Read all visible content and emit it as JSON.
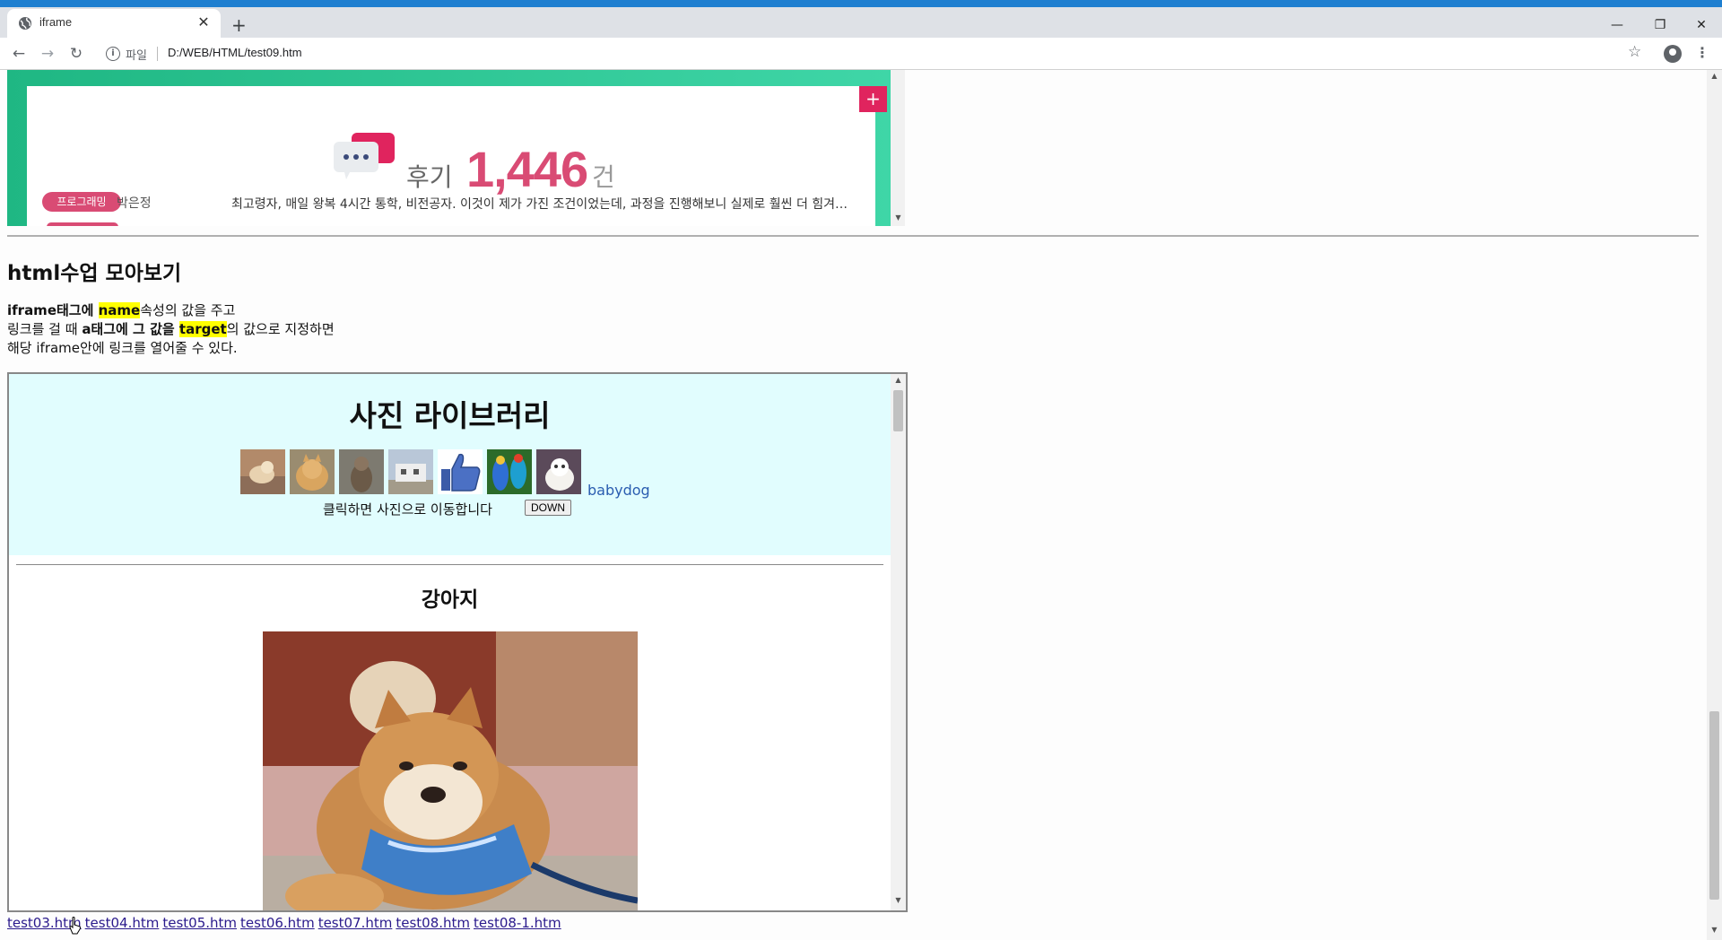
{
  "browser": {
    "tab_title": "iframe",
    "tab_close": "✕",
    "new_tab": "+",
    "window_controls": {
      "minimize": "—",
      "restore": "❐",
      "close": "✕"
    },
    "nav": {
      "back": "←",
      "forward": "→",
      "reload": "↻"
    },
    "address": {
      "info": "i",
      "scheme_label": "파일",
      "url": "D:/WEB/HTML/test09.htm"
    },
    "star": "☆",
    "menu": "⋮"
  },
  "review_banner": {
    "plus": "+",
    "label": "후기",
    "count": "1,446",
    "unit": "건",
    "badge": "프로그래밍",
    "author": "박은정",
    "text": "최고령자, 매일 왕복 4시간 통학, 비전공자. 이것이 제가 가진 조건이었는데, 과정을 진행해보니 실제로 훨씬 더 힘겨…",
    "colors": {
      "green": "#1fb783",
      "pink": "#d94b74",
      "plus_bg": "#e0245e"
    }
  },
  "section": {
    "heading": "html수업 모아보기",
    "desc": {
      "line1_a": "iframe태그에 ",
      "line1_hl": "name",
      "line1_b": "속성의 값을 주고",
      "line2_a": "링크를 걸 때 ",
      "line2_b": "a태그에 그 값을 ",
      "line2_hl": "target",
      "line2_c": "의 값으로 지정하면",
      "line3": "해당 iframe안에 링크를 열어줄 수 있다."
    }
  },
  "library": {
    "title": "사진 라이브러리",
    "broken_image_alt": "babydog",
    "caption": "클릭하면 사진으로 이동합니다",
    "down_button": "DOWN",
    "subtitle": "강아지",
    "bg_color": "#e1fdfe"
  },
  "links": [
    "test03.htm",
    "test04.htm",
    "test05.htm",
    "test06.htm",
    "test07.htm",
    "test08.htm",
    "test08-1.htm"
  ]
}
